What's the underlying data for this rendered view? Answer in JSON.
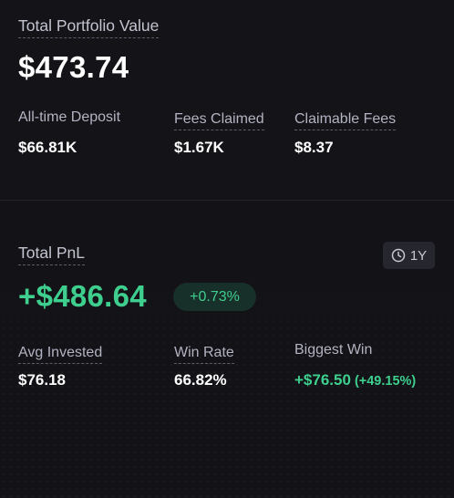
{
  "portfolio": {
    "title": "Total Portfolio Value",
    "value": "$473.74",
    "stats": [
      {
        "label": "All-time Deposit",
        "value": "$66.81K"
      },
      {
        "label": "Fees Claimed",
        "value": "$1.67K"
      },
      {
        "label": "Claimable Fees",
        "value": "$8.37"
      }
    ]
  },
  "pnl": {
    "title": "Total PnL",
    "value": "+$486.64",
    "change": "+0.73%",
    "range_label": "1Y",
    "range_icon": "clock-icon",
    "stats": [
      {
        "label": "Avg Invested",
        "value": "$76.18"
      },
      {
        "label": "Win Rate",
        "value": "66.82%"
      },
      {
        "label": "Biggest Win",
        "value": "+$76.50",
        "change": "(+49.15%)"
      }
    ]
  },
  "colors": {
    "background": "#121217",
    "positive": "#3ecf8e",
    "muted_text": "#b3b3c2"
  }
}
